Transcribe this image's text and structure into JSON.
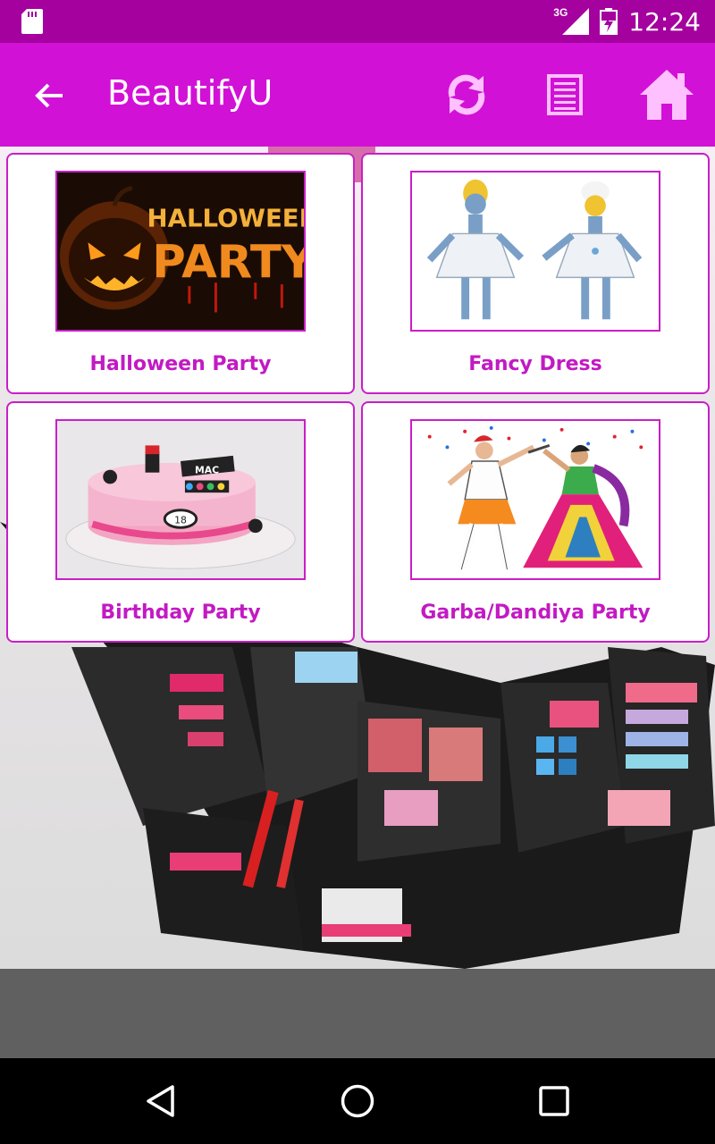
{
  "status_bar": {
    "time": "12:24",
    "network": "3G",
    "icons": [
      "sd-card-icon",
      "signal-icon",
      "battery-icon"
    ]
  },
  "app_bar": {
    "title": "BeautifyU",
    "icons": [
      "back-arrow-icon",
      "refresh-icon",
      "list-icon",
      "home-icon"
    ]
  },
  "grid": {
    "items": [
      {
        "label": "Halloween Party",
        "image": "halloween-party-image",
        "image_text_1": "HALLOWEEN",
        "image_text_2": "PARTY"
      },
      {
        "label": "Fancy Dress",
        "image": "fancy-dress-image"
      },
      {
        "label": "Birthday Party",
        "image": "birthday-cake-image",
        "image_text_1": "MAC",
        "image_text_2": "18"
      },
      {
        "label": "Garba/Dandiya Party",
        "image": "garba-dancers-image"
      }
    ]
  },
  "nav_bar": {
    "icons": [
      "back-triangle-icon",
      "home-circle-icon",
      "recents-square-icon"
    ]
  },
  "colors": {
    "status_bar": "#a4019e",
    "app_bar": "#d211d6",
    "accent": "#c91ec9",
    "label": "#c21ac3"
  }
}
